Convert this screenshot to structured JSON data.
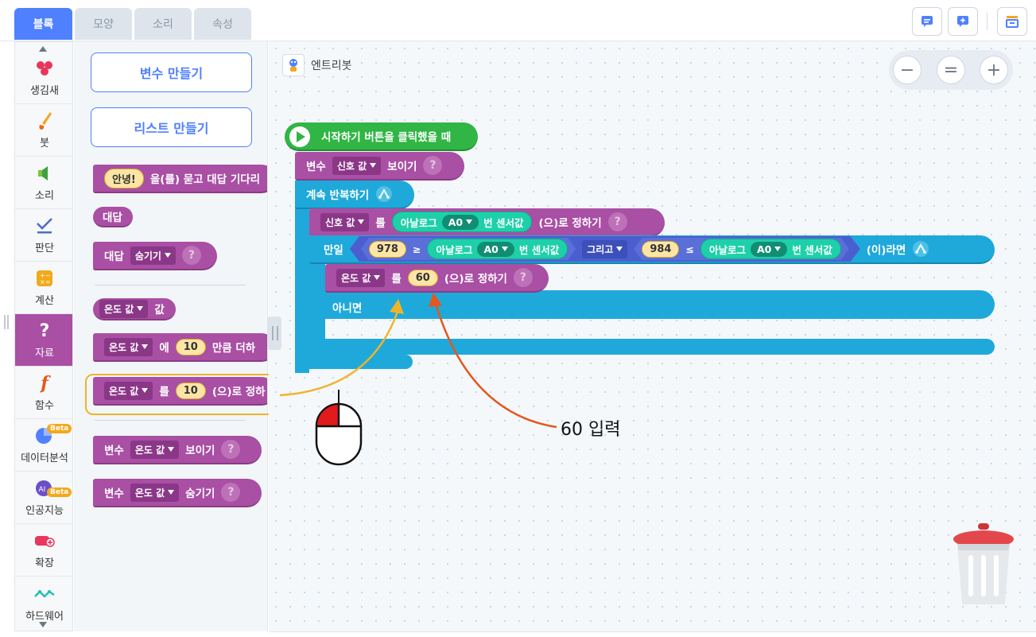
{
  "tabs": [
    "블록",
    "모양",
    "소리",
    "속성"
  ],
  "categories": [
    "생김새",
    "붓",
    "소리",
    "판단",
    "계산",
    "자료",
    "함수",
    "데이터분석",
    "인공지능",
    "확장",
    "하드웨어"
  ],
  "beta_label": "Beta",
  "ai_label": "AI",
  "palette": {
    "make_variable": "변수 만들기",
    "make_list": "리스트 만들기",
    "ask_hello": "안녕!",
    "ask_text": "을(를) 묻고 대답 기다리",
    "answer": "대답",
    "answer_prefix": "대답",
    "hide": "숨기기",
    "var_name": "온도 값",
    "value_label": "값",
    "of": "에",
    "num10": "10",
    "add_text": "만큼 더하",
    "to": "를",
    "set_text": "(으)로 정하",
    "var_label": "변수",
    "show": "보이기"
  },
  "canvas": {
    "object_name": "엔트리봇",
    "zoom_minus": "−",
    "zoom_reset": "=",
    "zoom_plus": "+",
    "when_start": "시작하기 버튼을 클릭했을 때",
    "var_label": "변수",
    "signal_var": "신호 값",
    "show": "보이기",
    "repeat": "계속 반복하기",
    "to": "를",
    "analog": "아날로그",
    "pin": "A0",
    "sensor_value": "번 센서값",
    "set_suffix": "(으)로 정하기",
    "if": "만일",
    "left_val": "978",
    "gte": "≥",
    "and": "그리고",
    "right_val": "984",
    "lte": "≤",
    "then": "(이)라면",
    "temp_var": "온도 값",
    "set_value": "60",
    "else": "아니면",
    "qmark": "?"
  },
  "annotation": "60 입력",
  "colors": {
    "purple": "#a94fa4",
    "blue": "#1fa9da",
    "green": "#31b544",
    "accent": "#4f80ff",
    "arrow_orange": "#e4571d",
    "arrow_yellow": "#f0b429"
  }
}
